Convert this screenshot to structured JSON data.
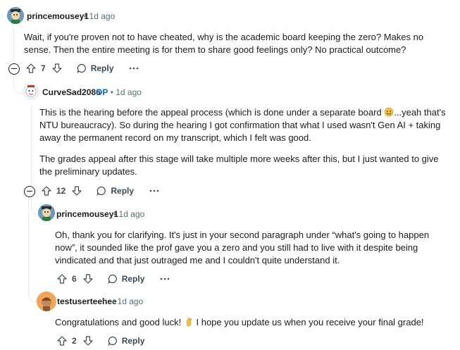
{
  "comments": [
    {
      "username": "princemousey1",
      "time": "1d ago",
      "body": [
        "Wait, if you're proven not to have cheated, why is the academic board keeping the zero? Makes no sense. Then the entire meeting is for them to share good feelings only? No practical outcome?"
      ],
      "votes": "7",
      "reply_label": "Reply"
    },
    {
      "username": "CurveSad2086",
      "op_badge": "OP",
      "time": "1d ago",
      "body_p1_a": "This is the hearing before the appeal process (which is done under a separate board",
      "body_p1_b": "...yeah that's NTU bureaucracy). So during the hearing I got confirmation that what I used wasn't Gen AI + taking away the permanent record on my transcript, which I felt was good.",
      "body_p2": "The grades appeal after this stage will take multiple more weeks after this, but I just wanted to give the preliminary updates.",
      "votes": "12",
      "reply_label": "Reply"
    },
    {
      "username": "princemousey1",
      "time": "1d ago",
      "body": [
        "Oh, thank you for clarifying. It's just in your second paragraph under “what's going to happen now”, it sounded like the prof gave you a zero and you still had to live with it despite being vindicated and that just outraged me and I couldn't quite understand it."
      ],
      "votes": "6",
      "reply_label": "Reply"
    },
    {
      "username": "testuserteehee",
      "time": "1d ago",
      "body_a": "Congratulations and good luck!",
      "body_b": "I hope you update us when you receive your final grade!",
      "votes": "2",
      "reply_label": "Reply"
    }
  ],
  "separator": "•",
  "colors": {
    "meta": "#576f76",
    "op": "#0a66c2",
    "thread_line": "#e5ebee"
  }
}
